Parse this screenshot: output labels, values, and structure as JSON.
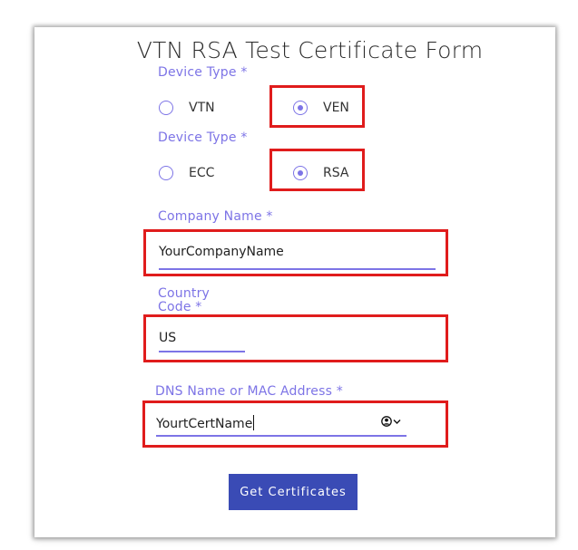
{
  "form": {
    "title": "VTN RSA Test Certificate Form",
    "device_type_group1": {
      "label": "Device Type *",
      "options": [
        {
          "label": "VTN",
          "checked": false
        },
        {
          "label": "VEN",
          "checked": true
        }
      ]
    },
    "device_type_group2": {
      "label": "Device Type *",
      "options": [
        {
          "label": "ECC",
          "checked": false
        },
        {
          "label": "RSA",
          "checked": true
        }
      ]
    },
    "company_name": {
      "label": "Company Name *",
      "value": "YourCompanyName"
    },
    "country_code": {
      "label_line1": "Country",
      "label_line2": "Code *",
      "value": "US"
    },
    "dns_name": {
      "label": "DNS Name or MAC Address *",
      "value": "YourtCertName"
    },
    "submit_label": "Get Certificates"
  },
  "icons": {
    "autofill": "user-circle-icon",
    "dropdown": "chevron-down-icon"
  },
  "colors": {
    "accent": "#7d74e6",
    "button": "#3a4bb5",
    "highlight_box": "#e01c1c"
  }
}
